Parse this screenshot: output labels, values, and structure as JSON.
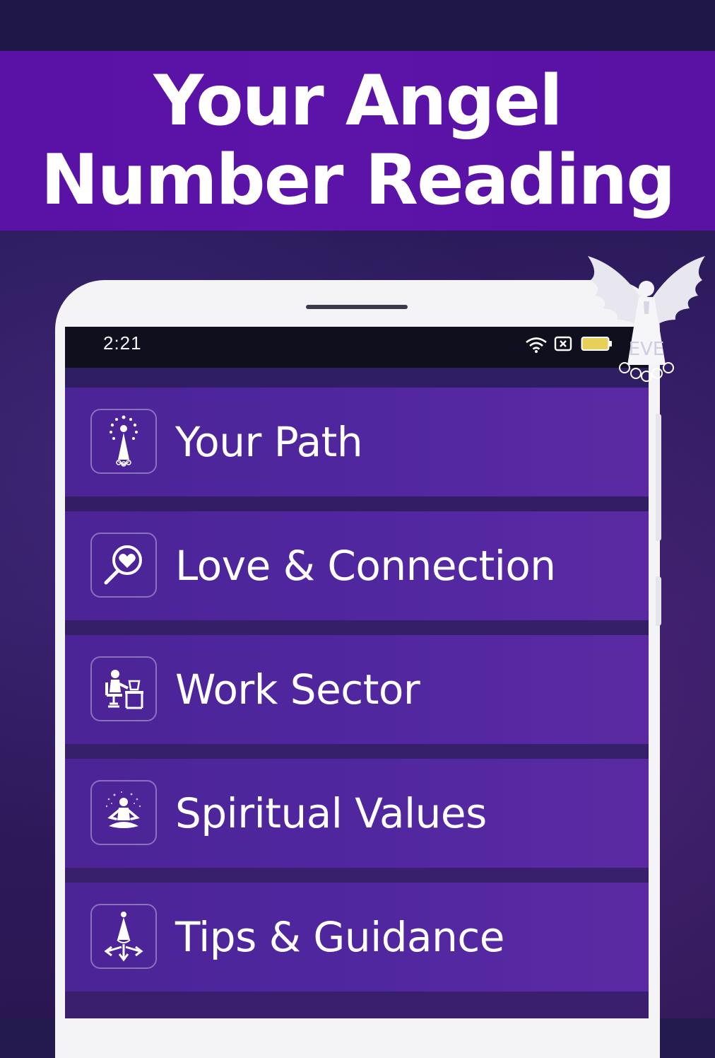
{
  "banner": {
    "title_line1": "Your Angel",
    "title_line2": "Number Reading"
  },
  "status_bar": {
    "time": "2:21"
  },
  "menu": [
    {
      "label": "Your Path",
      "icon": "angel-figure-icon"
    },
    {
      "label": "Love & Connection",
      "icon": "heart-search-icon"
    },
    {
      "label": "Work Sector",
      "icon": "desk-worker-icon"
    },
    {
      "label": "Spiritual Values",
      "icon": "meditation-icon"
    },
    {
      "label": "Tips & Guidance",
      "icon": "guidance-arrows-icon"
    }
  ],
  "logo": {
    "text": "EVE"
  },
  "colors": {
    "banner": "#5b13a8",
    "menu_item": "#5127a0",
    "background": "#2a1a5c",
    "status_bar": "#100f1e"
  }
}
